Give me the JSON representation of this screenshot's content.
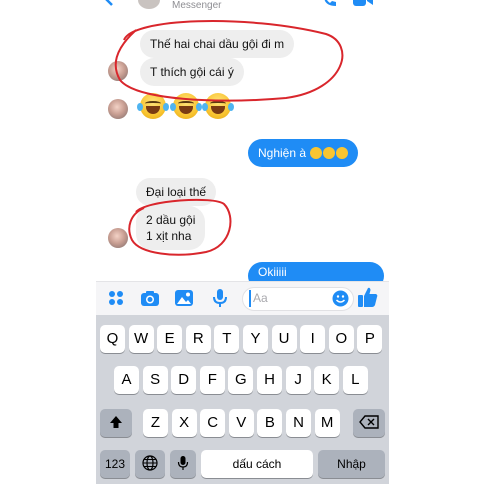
{
  "header": {
    "subtitle": "Messenger"
  },
  "messages": {
    "m1": "Thế hai chai dầu gội đi m",
    "m2": "T thích gội cái ý",
    "m3_text": "Nghiện à",
    "m4": "Đại loại thế",
    "m5_line1": "2 dầu gội",
    "m5_line2": "1 xịt nha",
    "m6_partial": "Okiiiii"
  },
  "composer": {
    "placeholder": "Aa"
  },
  "keyboard": {
    "row1": [
      "Q",
      "W",
      "E",
      "R",
      "T",
      "Y",
      "U",
      "I",
      "O",
      "P"
    ],
    "row2": [
      "A",
      "S",
      "D",
      "F",
      "G",
      "H",
      "J",
      "K",
      "L"
    ],
    "row3": [
      "Z",
      "X",
      "C",
      "V",
      "B",
      "N",
      "M"
    ],
    "key_123": "123",
    "space_label": "dấu cách",
    "return_label": "Nhập"
  },
  "colors": {
    "accent": "#1f8cf5",
    "annotation": "#d9262c"
  },
  "icons": [
    "back-arrow-icon",
    "phone-icon",
    "video-icon",
    "apps-icon",
    "camera-icon",
    "gallery-icon",
    "microphone-icon",
    "emoji-icon",
    "thumbs-up-icon",
    "shift-icon",
    "backspace-icon",
    "globe-icon",
    "mic-key-icon"
  ]
}
